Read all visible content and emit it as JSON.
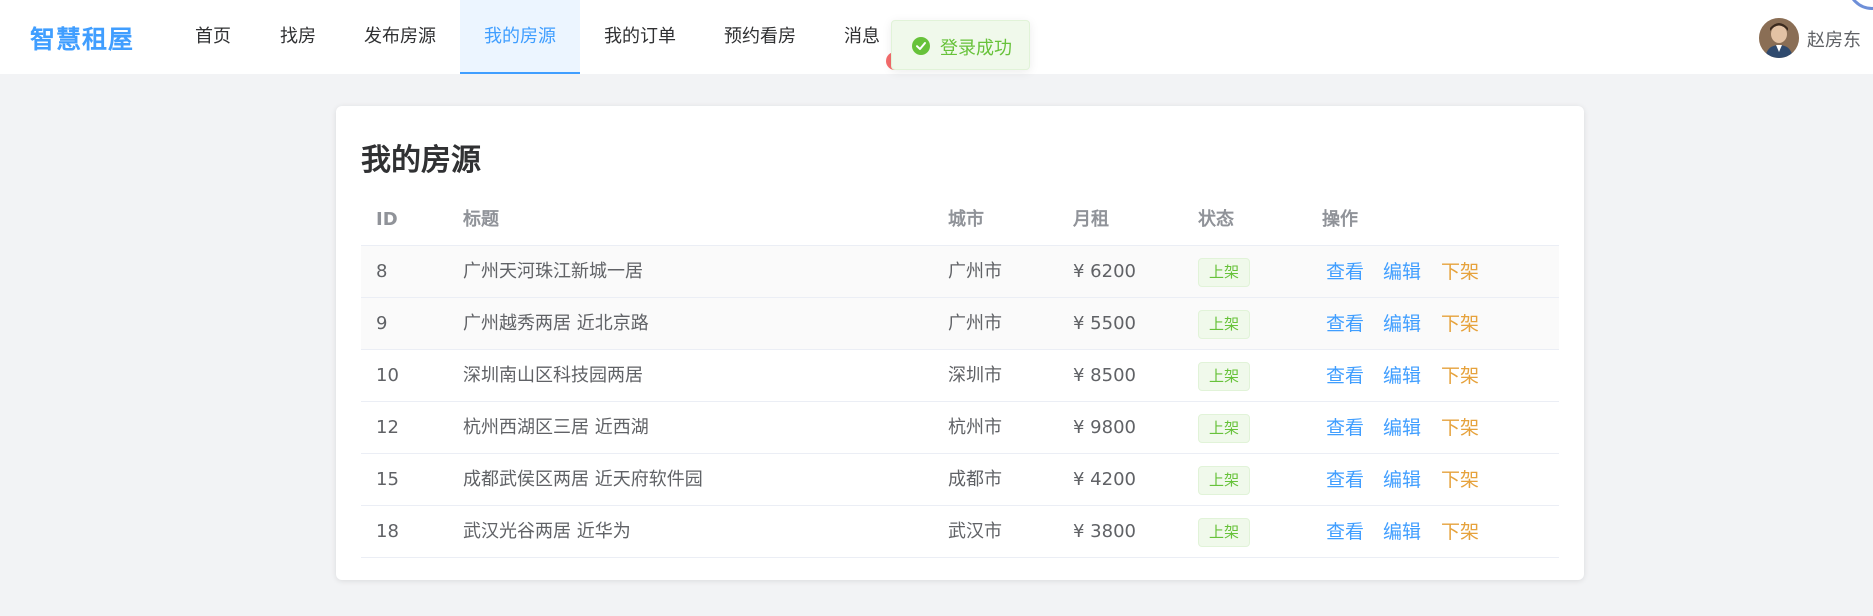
{
  "header": {
    "logo": "智慧租屋",
    "nav": [
      {
        "label": "首页",
        "active": false
      },
      {
        "label": "找房",
        "active": false
      },
      {
        "label": "发布房源",
        "active": false
      },
      {
        "label": "我的房源",
        "active": true
      },
      {
        "label": "我的订单",
        "active": false
      },
      {
        "label": "预约看房",
        "active": false
      },
      {
        "label": "消息",
        "active": false
      }
    ],
    "user": {
      "name": "赵房东",
      "avatar_icon": "user-avatar"
    }
  },
  "toast": {
    "text": "登录成功",
    "icon": "check-circle-icon",
    "color": "#67c23a"
  },
  "page": {
    "title": "我的房源",
    "table": {
      "columns": [
        "ID",
        "标题",
        "城市",
        "月租",
        "状态",
        "操作"
      ],
      "rows": [
        {
          "id": "8",
          "title": "广州天河珠江新城一居",
          "city": "广州市",
          "rent": "¥ 6200",
          "status": "上架"
        },
        {
          "id": "9",
          "title": "广州越秀两居 近北京路",
          "city": "广州市",
          "rent": "¥ 5500",
          "status": "上架"
        },
        {
          "id": "10",
          "title": "深圳南山区科技园两居",
          "city": "深圳市",
          "rent": "¥ 8500",
          "status": "上架"
        },
        {
          "id": "12",
          "title": "杭州西湖区三居 近西湖",
          "city": "杭州市",
          "rent": "¥ 9800",
          "status": "上架"
        },
        {
          "id": "15",
          "title": "成都武侯区两居 近天府软件园",
          "city": "成都市",
          "rent": "¥ 4200",
          "status": "上架"
        },
        {
          "id": "18",
          "title": "武汉光谷两居 近华为",
          "city": "武汉市",
          "rent": "¥ 3800",
          "status": "上架"
        }
      ],
      "actions": {
        "view": "查看",
        "edit": "编辑",
        "off": "下架"
      }
    }
  },
  "colors": {
    "primary": "#409eff",
    "success": "#67c23a",
    "warning": "#e6a23c"
  }
}
